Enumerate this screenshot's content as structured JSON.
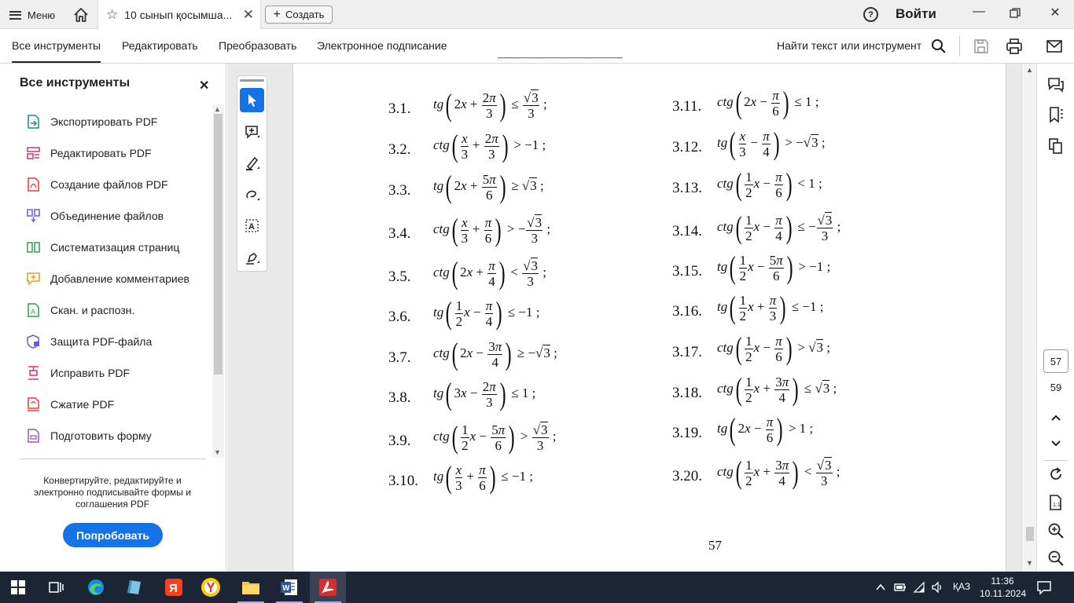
{
  "topbar": {
    "menu_label": "Меню",
    "tab_title": "10 сынып қосымша...",
    "create_label": "Создать",
    "signin_label": "Войти"
  },
  "toolbar": {
    "tabs": [
      "Все инструменты",
      "Редактировать",
      "Преобразовать",
      "Электронное подписание"
    ],
    "find_label": "Найти текст или инструмент"
  },
  "left_panel": {
    "title": "Все инструменты",
    "items": [
      {
        "label": "Экспортировать PDF",
        "icon": "export-pdf-icon",
        "color": "#1f8a8f"
      },
      {
        "label": "Редактировать PDF",
        "icon": "edit-pdf-icon",
        "color": "#d6336c"
      },
      {
        "label": "Создание файлов PDF",
        "icon": "create-pdf-icon",
        "color": "#e03c3c"
      },
      {
        "label": "Объединение файлов",
        "icon": "combine-files-icon",
        "color": "#6b5bd6"
      },
      {
        "label": "Систематизация страниц",
        "icon": "organize-pages-icon",
        "color": "#2e9e4f"
      },
      {
        "label": "Добавление комментариев",
        "icon": "comment-icon",
        "color": "#e0a11b"
      },
      {
        "label": "Скан. и распозн.",
        "icon": "scan-ocr-icon",
        "color": "#2e9e4f"
      },
      {
        "label": "Защита PDF-файла",
        "icon": "protect-pdf-icon",
        "color": "#6b5bd6"
      },
      {
        "label": "Исправить PDF",
        "icon": "redact-pdf-icon",
        "color": "#d6336c"
      },
      {
        "label": "Сжатие PDF",
        "icon": "compress-pdf-icon",
        "color": "#e03c3c"
      },
      {
        "label": "Подготовить форму",
        "icon": "prepare-form-icon",
        "color": "#9b59b6"
      }
    ],
    "promo_text": "Конвертируйте, редактируйте и электронно подписывайте формы и соглашения PDF",
    "try_label": "Попробовать"
  },
  "problems_left": [
    {
      "num": "3.1."
    },
    {
      "num": "3.2."
    },
    {
      "num": "3.3."
    },
    {
      "num": "3.4."
    },
    {
      "num": "3.5."
    },
    {
      "num": "3.6."
    },
    {
      "num": "3.7."
    },
    {
      "num": "3.8."
    },
    {
      "num": "3.9."
    },
    {
      "num": "3.10."
    }
  ],
  "problems_right": [
    {
      "num": "3.11."
    },
    {
      "num": "3.12."
    },
    {
      "num": "3.13."
    },
    {
      "num": "3.14."
    },
    {
      "num": "3.15."
    },
    {
      "num": "3.16."
    },
    {
      "num": "3.17."
    },
    {
      "num": "3.18."
    },
    {
      "num": "3.19."
    },
    {
      "num": "3.20."
    }
  ],
  "doc": {
    "page_number": "57"
  },
  "right_rail": {
    "current_page": "57",
    "total_pages": "59"
  },
  "taskbar": {
    "lang": "ҚАЗ",
    "time": "11:36",
    "date": "10.11.2024"
  },
  "colors": {
    "accent": "#1473e6",
    "taskbar": "#1c2536"
  }
}
